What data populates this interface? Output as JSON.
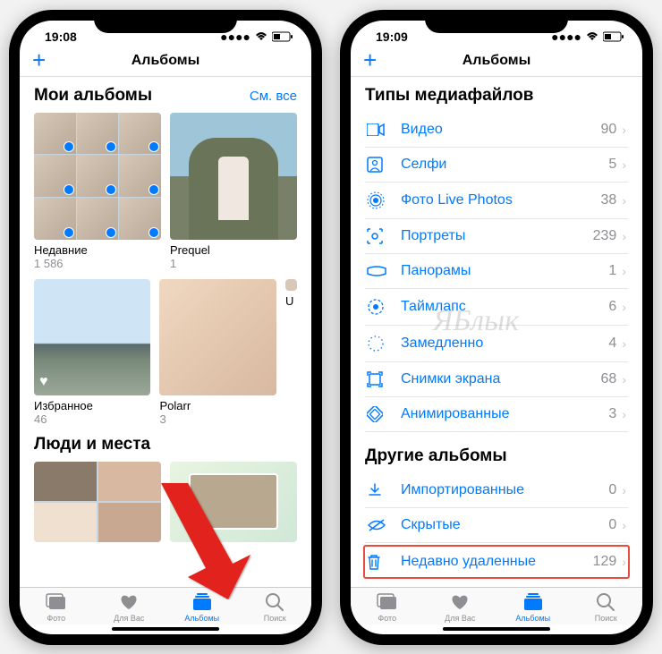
{
  "watermark": "ЯБлык",
  "left": {
    "time": "19:08",
    "nav_title": "Альбомы",
    "section1_title": "Мои альбомы",
    "see_all": "См. все",
    "albums_row1": [
      {
        "name": "Недавние",
        "count": "1 586"
      },
      {
        "name": "Prequel",
        "count": "1"
      }
    ],
    "albums_row2": [
      {
        "name": "Избранное",
        "count": "46"
      },
      {
        "name": "Polarr",
        "count": "3"
      },
      {
        "name": "U"
      }
    ],
    "section2_title": "Люди и места"
  },
  "right": {
    "time": "19:09",
    "nav_title": "Альбомы",
    "section1_title": "Типы медиафайлов",
    "media_types": [
      {
        "icon": "video",
        "label": "Видео",
        "count": "90"
      },
      {
        "icon": "selfie",
        "label": "Селфи",
        "count": "5"
      },
      {
        "icon": "live",
        "label": "Фото Live Photos",
        "count": "38"
      },
      {
        "icon": "portrait",
        "label": "Портреты",
        "count": "239"
      },
      {
        "icon": "panorama",
        "label": "Панорамы",
        "count": "1"
      },
      {
        "icon": "timelapse",
        "label": "Таймлапс",
        "count": "6"
      },
      {
        "icon": "slomo",
        "label": "Замедленно",
        "count": "4"
      },
      {
        "icon": "screenshot",
        "label": "Снимки экрана",
        "count": "68"
      },
      {
        "icon": "animated",
        "label": "Анимированные",
        "count": "3"
      }
    ],
    "section2_title": "Другие альбомы",
    "other_albums": [
      {
        "icon": "import",
        "label": "Импортированные",
        "count": "0"
      },
      {
        "icon": "hidden",
        "label": "Скрытые",
        "count": "0"
      },
      {
        "icon": "trash",
        "label": "Недавно удаленные",
        "count": "129",
        "highlight": true
      }
    ]
  },
  "tabs": [
    {
      "id": "photos",
      "label": "Фото"
    },
    {
      "id": "foryou",
      "label": "Для Вас"
    },
    {
      "id": "albums",
      "label": "Альбомы",
      "active": true
    },
    {
      "id": "search",
      "label": "Поиск"
    }
  ]
}
